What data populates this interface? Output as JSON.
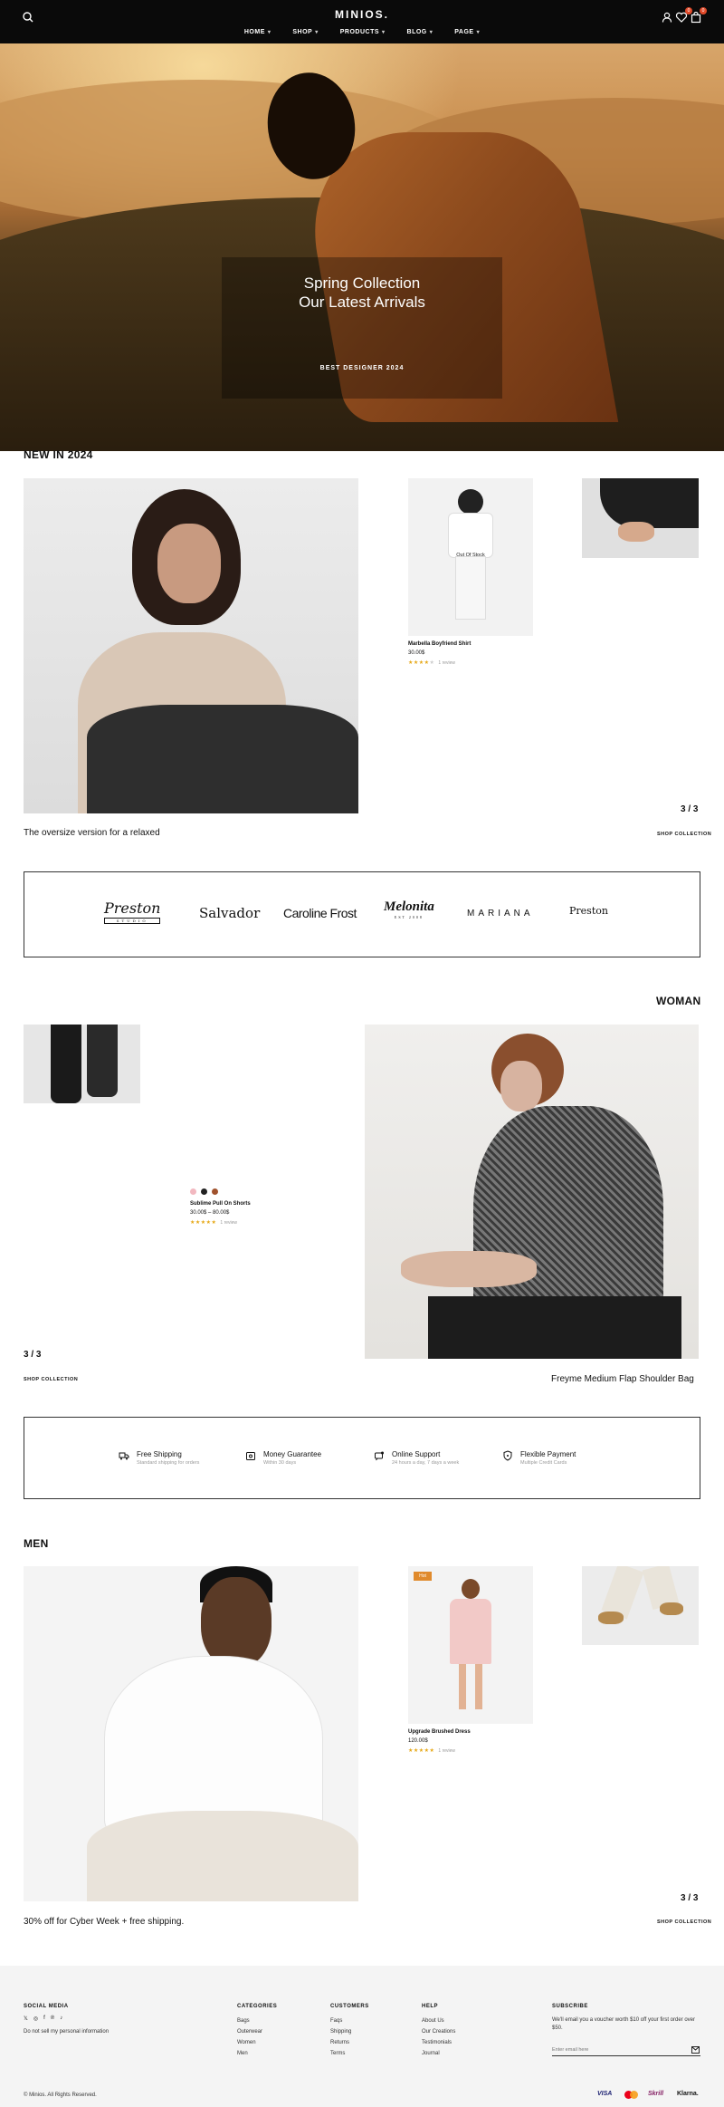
{
  "header": {
    "logo": "MINIOS.",
    "nav": [
      {
        "label": "HOME"
      },
      {
        "label": "SHOP"
      },
      {
        "label": "PRODUCTS"
      },
      {
        "label": "BLOG"
      },
      {
        "label": "PAGE"
      }
    ],
    "wishlist_count": "0",
    "cart_count": "0",
    "icons": [
      "search-icon",
      "user-icon",
      "heart-icon",
      "cart-icon"
    ]
  },
  "hero": {
    "title_line1": "Spring Collection",
    "title_line2": "Our Latest Arrivals",
    "subtitle": "BEST DESIGNER 2024"
  },
  "new_in": {
    "title": "NEW IN 2024",
    "product": {
      "name": "Marbella Boyfriend Shirt",
      "price": "30.00$",
      "badge": "Out Of Stock",
      "rating": 4,
      "reviews": "1 review"
    },
    "counter": "3 / 3",
    "caption": "The oversize version for a relaxed",
    "link": "SHOP COLLECTION"
  },
  "brands": [
    "Preston",
    "Salvador",
    "Caroline Frost",
    "Melonita",
    "MARIANA",
    "Preston"
  ],
  "brand_subs": [
    "STUDIO",
    "",
    "",
    "EST 2008",
    "",
    ""
  ],
  "woman": {
    "title": "WOMAN",
    "product": {
      "name": "Sublime Pull On Shorts",
      "price": "30.00$ – 80.00$",
      "rating": 5,
      "reviews": "1 review",
      "swatches": [
        "#f2b8c0",
        "#222222",
        "#a0522d"
      ]
    },
    "counter": "3 / 3",
    "link": "SHOP COLLECTION",
    "caption": "Freyme Medium Flap Shoulder Bag"
  },
  "features": [
    {
      "title": "Free Shipping",
      "desc": "Standard shipping for orders",
      "icon": "truck-icon"
    },
    {
      "title": "Money Guarantee",
      "desc": "Within 30 days",
      "icon": "money-icon"
    },
    {
      "title": "Online Support",
      "desc": "24 hours a day, 7 days a week",
      "icon": "support-icon"
    },
    {
      "title": "Flexible Payment",
      "desc": "Multiple Credit Cards",
      "icon": "shield-icon"
    }
  ],
  "men": {
    "title": "MEN",
    "product": {
      "name": "Upgrade Brushed Dress",
      "price": "120.00$",
      "badge": "Hot",
      "rating": 5,
      "reviews": "1 review"
    },
    "counter": "3 / 3",
    "caption": "30% off for Cyber Week + free shipping.",
    "link": "SHOP COLLECTION"
  },
  "footer": {
    "social_title": "SOCIAL MEDIA",
    "social_icons": [
      "x-icon",
      "instagram-icon",
      "facebook-icon",
      "pinterest-icon",
      "tiktok-icon"
    ],
    "privacy": "Do not sell my personal information",
    "categories_title": "CATEGORIES",
    "categories": [
      "Bags",
      "Outerwear",
      "Women",
      "Men"
    ],
    "customers_title": "CUSTOMERS",
    "customers": [
      "Faqs",
      "Shipping",
      "Returns",
      "Terms"
    ],
    "help_title": "HELP",
    "help": [
      "About Us",
      "Our Creations",
      "Testimonials",
      "Journal"
    ],
    "subscribe_title": "SUBSCRIBE",
    "subscribe_text": "We'll email you a voucher worth $10 off your first order over $50.",
    "email_placeholder": "Enter email here",
    "copyright": "© Minios. All Rights Reserved.",
    "payments": [
      "VISA",
      "Skrill",
      "Klarna."
    ]
  }
}
